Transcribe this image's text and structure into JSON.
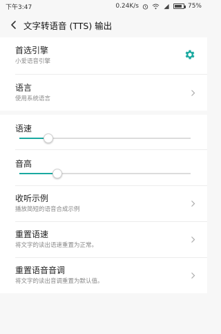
{
  "status_bar": {
    "time": "下午3:47",
    "net_speed": "0.24K/s",
    "battery_pct": "75%",
    "battery_level": 0.75,
    "icons": [
      "alarm-icon",
      "wifi-icon",
      "signal-icon",
      "battery-icon"
    ]
  },
  "header": {
    "title": "文字转语音 (TTS) 输出",
    "back_icon": "back-arrow-icon"
  },
  "settings": {
    "engine": {
      "label": "首选引擎",
      "sub": "小爱语音引擎",
      "icon": "gear-icon"
    },
    "language": {
      "label": "语言",
      "sub": "使用系统语言"
    }
  },
  "sliders": {
    "speed": {
      "label": "语速",
      "value": 0.17
    },
    "pitch": {
      "label": "音高",
      "value": 0.22
    }
  },
  "actions": {
    "sample": {
      "label": "收听示例",
      "sub": "播放简短的语音合成示例"
    },
    "reset_speed": {
      "label": "重置语速",
      "sub": "将文字的读出语速重置为正常。"
    },
    "reset_pitch": {
      "label": "重置语音音调",
      "sub": "将文字的读出音调重置为默认值。"
    }
  },
  "colors": {
    "accent": "#1aa9a0",
    "background": "#f7f7f7",
    "card": "#ffffff"
  }
}
